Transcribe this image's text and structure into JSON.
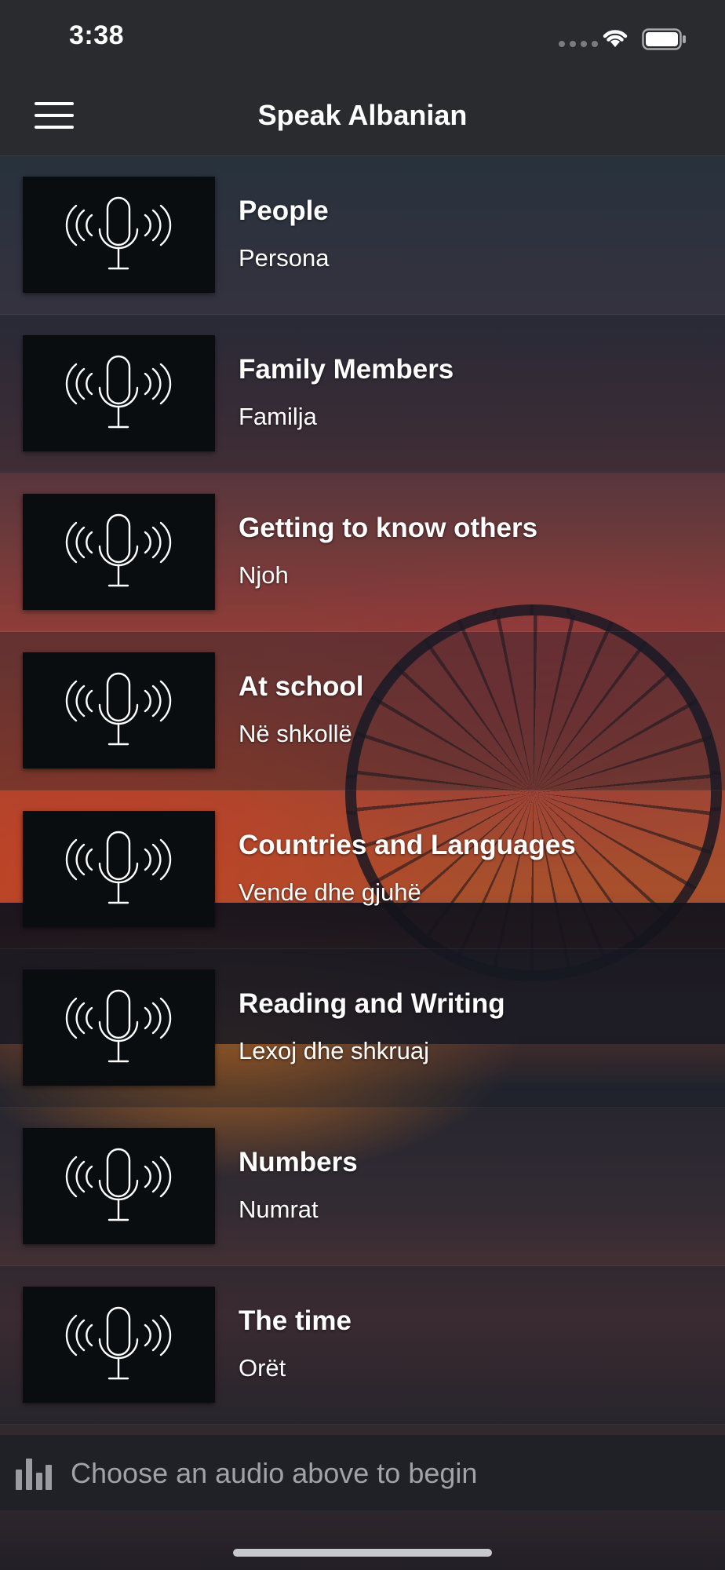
{
  "status_bar": {
    "time": "3:38"
  },
  "nav": {
    "title": "Speak Albanian"
  },
  "items": [
    {
      "title": "People",
      "subtitle": "Persona"
    },
    {
      "title": "Family Members",
      "subtitle": "Familja"
    },
    {
      "title": "Getting to know others",
      "subtitle": "Njoh"
    },
    {
      "title": "At school",
      "subtitle": "Në shkollë"
    },
    {
      "title": "Countries and Languages",
      "subtitle": "Vende dhe gjuhë"
    },
    {
      "title": "Reading and Writing",
      "subtitle": "Lexoj dhe shkruaj"
    },
    {
      "title": "Numbers",
      "subtitle": "Numrat"
    },
    {
      "title": "The time",
      "subtitle": "Orët"
    }
  ],
  "player": {
    "prompt": "Choose an audio above to begin"
  },
  "icons": {
    "menu": "hamburger-menu-icon",
    "thumbnail": "microphone-broadcast-icon",
    "player": "equalizer-icon",
    "wifi": "wifi-icon",
    "battery": "battery-icon"
  }
}
